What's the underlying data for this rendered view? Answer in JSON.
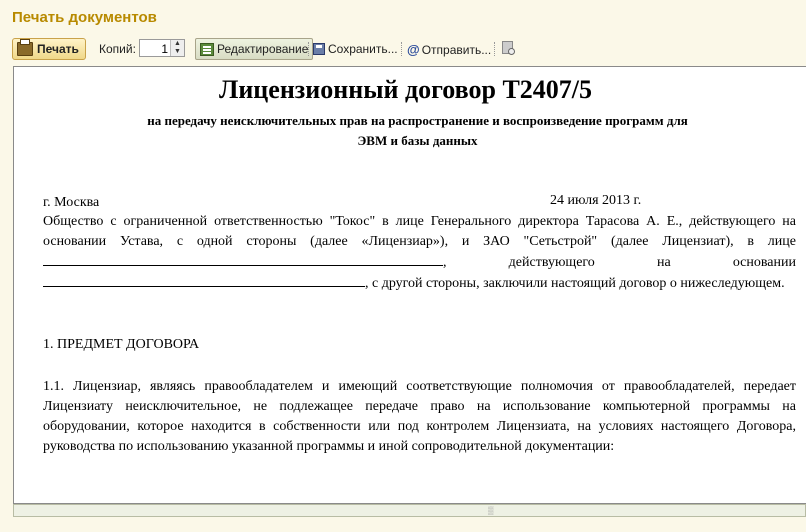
{
  "window": {
    "title": "Печать документов"
  },
  "toolbar": {
    "print_label": "Печать",
    "copies_label": "Копий:",
    "copies_value": "1",
    "edit_label": "Редактирование",
    "save_label": "Сохранить...",
    "send_label": "Отправить...",
    "send_icon": "@"
  },
  "document": {
    "title": "Лицензионный договор Т2407/5",
    "subtitle_line1": "на передачу неисключительных прав на распространение и воспроизведение программ для",
    "subtitle_line2": "ЭВМ и базы данных",
    "city": "г. Москва",
    "date": "24 июля 2013 г.",
    "para1": {
      "part1": "Общество с ограниченной ответственностью \"Токос\" в лице Генерального директора Тарасова А. Е., действующего на основании Устава, с одной стороны (далее «Лицензиар»), и ЗАО \"Сетьстрой\" (далее Лицензиат), в лице",
      "part2": ", действующего на основании",
      "part3": ", с другой стороны, заключили настоящий договор о нижеследующем."
    },
    "section1_heading": "1. ПРЕДМЕТ ДОГОВОРА",
    "para2": "1.1. Лицензиар, являясь правообладателем и имеющий соответствующие полномочия от правообладателей, передает Лицензиату неисключительное, не подлежащее передаче право на использование компьютерной программы на оборудовании, которое находится в собственности или под контролем Лицензиата, на условиях настоящего Договора, руководства по использованию указанной программы и иной сопроводительной документации:"
  },
  "icons": {
    "print": "printer-icon",
    "edit": "edit-icon",
    "save": "floppy-disk-icon",
    "send": "at-sign-icon",
    "preview": "page-preview-icon"
  },
  "colors": {
    "title": "#b88a00",
    "background": "#fbf8e8"
  }
}
